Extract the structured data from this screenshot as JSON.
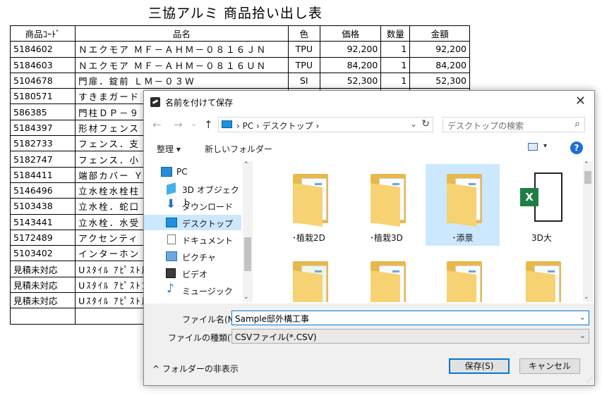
{
  "sheet": {
    "title": "三協アルミ 商品拾い出し表",
    "headers": [
      "商品ｺｰﾄﾞ",
      "品名",
      "色",
      "価格",
      "数量",
      "金額"
    ],
    "rows": [
      [
        "5184602",
        "Ｎエクモア ＭＦ－ＡＨＭ－０８１６ＪＮ",
        "TPU",
        "92,200",
        "1",
        "92,200"
      ],
      [
        "5184603",
        "Ｎエクモア ＭＦ－ＡＨＭ－０８１６ＵＮ",
        "TPU",
        "84,200",
        "1",
        "84,200"
      ],
      [
        "5104678",
        "門扉．錠前 ＬＭ－０３Ｗ",
        "SI",
        "52,300",
        "1",
        "52,300"
      ],
      [
        "5180571",
        "すきまガード",
        "",
        "",
        "",
        ""
      ],
      [
        "586385",
        "門柱ＤＰ－９",
        "",
        "",
        "",
        ""
      ],
      [
        "5184397",
        "形材フェンス",
        "",
        "",
        "",
        ""
      ],
      [
        "5182733",
        "フェンス．支",
        "",
        "",
        "",
        ""
      ],
      [
        "5182747",
        "フェンス．小",
        "",
        "",
        "",
        ""
      ],
      [
        "5184411",
        "端部カバー Ｙ",
        "",
        "",
        "",
        ""
      ],
      [
        "5146496",
        "立水栓水栓柱",
        "",
        "",
        "",
        ""
      ],
      [
        "5103438",
        "立水栓．蛇口",
        "",
        "",
        "",
        ""
      ],
      [
        "5143441",
        "立水栓．水受",
        "",
        "",
        "",
        ""
      ],
      [
        "5172489",
        "アクセンティ",
        "",
        "",
        "",
        ""
      ],
      [
        "5103402",
        "インターホン",
        "",
        "",
        "",
        ""
      ],
      [
        "見積未対応",
        "Uｽﾀｲﾙ ｱﾋﾟｽﾄ屋",
        "",
        "",
        "",
        ""
      ],
      [
        "見積未対応",
        "Uｽﾀｲﾙ ｱﾋﾟｽﾄﾌ",
        "",
        "",
        "",
        ""
      ],
      [
        "見積未対応",
        "Uｽﾀｲﾙ ｱﾋﾟｽﾄ用",
        "",
        "",
        "",
        ""
      ],
      [
        "",
        "",
        "",
        "",
        "",
        ""
      ]
    ]
  },
  "dialog": {
    "title": "名前を付けて保存",
    "close_glyph": "✕",
    "nav": {
      "back_glyph": "←",
      "forward_glyph": "→",
      "recent_glyph": "⌄",
      "up_glyph": "↑",
      "address": "›  PC  ›  デスクトップ  ›",
      "address_dropdown_glyph": "⌄",
      "refresh_glyph": "↻",
      "search_placeholder": "デスクトップの検索",
      "search_glyph": "⌕"
    },
    "toolbar": {
      "organize": "整理 ▾",
      "new_folder": "新しいフォルダー",
      "view_dropdown_glyph": "▾",
      "help_glyph": "?"
    },
    "nav_pane": {
      "items": [
        {
          "label": "PC",
          "icon": "pc-icon"
        },
        {
          "label": "3D オブジェクト",
          "icon": "3d-objects-icon"
        },
        {
          "label": "ダウンロード",
          "icon": "download-icon",
          "glyph": "⬇"
        },
        {
          "label": "デスクトップ",
          "icon": "desktop-icon",
          "selected": true
        },
        {
          "label": "ドキュメント",
          "icon": "document-icon"
        },
        {
          "label": "ピクチャ",
          "icon": "pictures-icon"
        },
        {
          "label": "ビデオ",
          "icon": "video-icon"
        },
        {
          "label": "ミュージック",
          "icon": "music-icon",
          "glyph": "♪"
        }
      ]
    },
    "scroll": {
      "up_glyph": "⌃",
      "down_glyph": "⌄"
    },
    "files": [
      {
        "label": "･植栽2D",
        "type": "folder"
      },
      {
        "label": "･植栽3D",
        "type": "folder"
      },
      {
        "label": "･添景",
        "type": "folder",
        "selected": true
      },
      {
        "label": "3D大",
        "type": "excel",
        "badge": "X"
      },
      {
        "label": "",
        "type": "folder"
      },
      {
        "label": "",
        "type": "folder"
      },
      {
        "label": "",
        "type": "folder"
      },
      {
        "label": "",
        "type": "folder"
      }
    ],
    "filename_label": "ファイル名(N):",
    "filename_value": "Sample邸外構工事",
    "filetype_label": "ファイルの種類(T):",
    "filetype_value": "CSVファイル(*.CSV)",
    "field_dropdown_glyph": "⌄",
    "hide_folders": "^ フォルダーの非表示",
    "save_button": "保存(S)",
    "cancel_button": "キャンセル",
    "grip_glyph": "⋰"
  }
}
